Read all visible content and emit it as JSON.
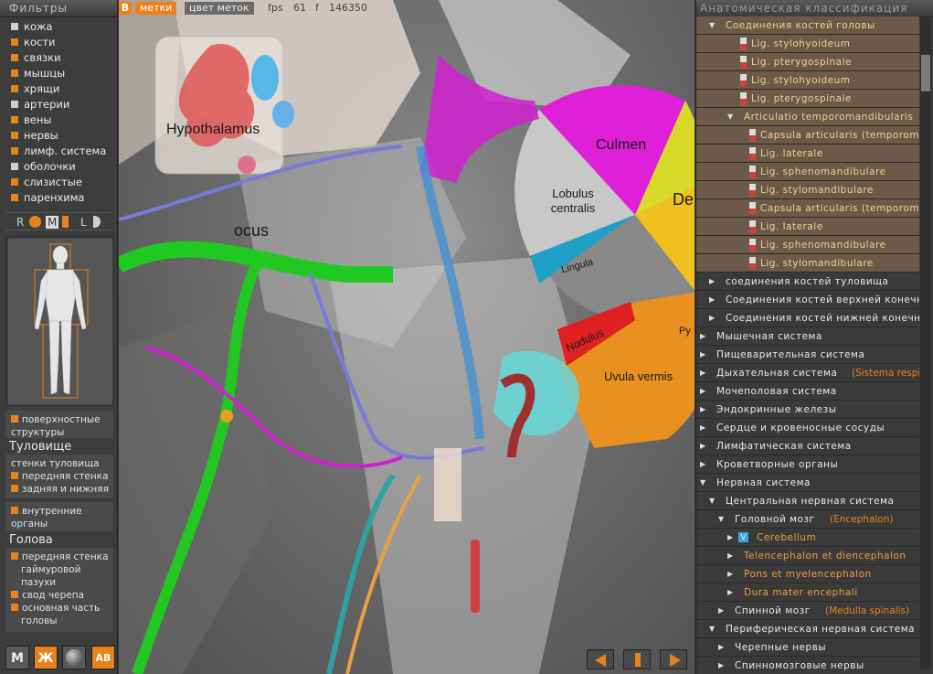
{
  "left": {
    "title": "Фильтры",
    "filters": [
      {
        "label": "кожа",
        "color": "#cfcfcf"
      },
      {
        "label": "кости",
        "color": "#e8821c"
      },
      {
        "label": "связки",
        "color": "#e8821c"
      },
      {
        "label": "мышцы",
        "color": "#e8821c"
      },
      {
        "label": "хрящи",
        "color": "#e8821c"
      },
      {
        "label": "артерии",
        "color": "#cfcfcf"
      },
      {
        "label": "вены",
        "color": "#e8821c"
      },
      {
        "label": "нервы",
        "color": "#e8821c"
      },
      {
        "label": "лимф. система",
        "color": "#e8821c"
      },
      {
        "label": "оболочки",
        "color": "#cfcfcf"
      },
      {
        "label": "слизистые",
        "color": "#e8821c"
      },
      {
        "label": "паренхима",
        "color": "#e8821c"
      }
    ],
    "lod": {
      "r": "R",
      "m": "M",
      "l": "L"
    },
    "surface": "поверхностные структуры",
    "trunk_title": "Туловище",
    "trunk": {
      "walls": "стенки туловища",
      "front": "передняя стенка",
      "back": "задняя и нижняя"
    },
    "internal": "внутренние органы",
    "head_title": "Голова",
    "head": [
      "передняя стенка гаймуровой пазухи",
      "свод черепа",
      "основная часть головы"
    ],
    "buttons": {
      "m": "М",
      "zh": "Ж",
      "ab": "АВ"
    }
  },
  "viewport": {
    "tab_b": "B",
    "tab_marks": "метки",
    "tab_color": "цвет  меток",
    "fps_label": "fps",
    "fps": "61",
    "f_label": "f",
    "f_value": "146350",
    "labels": {
      "hypothalamus": "Hypothalamus",
      "culmen": "Culmen",
      "lobulus": "Lobulus centralis",
      "lingula": "Lingula",
      "nodulus": "Nodulus",
      "uvula": "Uvula  vermis",
      "locus": "ocus",
      "declive": "De",
      "py": "Py"
    }
  },
  "right": {
    "title": "Анатомическая классификация",
    "rows": [
      {
        "text": "Соединения  костей  головы",
        "indent": 1,
        "arrow": "down",
        "style": "lig"
      },
      {
        "text": "Lig.  stylohyoideum",
        "indent": 4,
        "pin": "ar",
        "style": "lig"
      },
      {
        "text": "Lig.  pterygospinale",
        "indent": 4,
        "pin": "ar",
        "style": "lig"
      },
      {
        "text": "Lig.  stylohyoideum",
        "indent": 4,
        "pin": "ar",
        "style": "lig"
      },
      {
        "text": "Lig.  pterygospinale",
        "indent": 4,
        "pin": "ar",
        "style": "lig"
      },
      {
        "text": "Articulatio  temporomandibularis",
        "indent": 3,
        "arrow": "down",
        "style": "lig"
      },
      {
        "text": "Capsula  articularis  (temporoma",
        "indent": 5,
        "pin": "ar",
        "style": "lig"
      },
      {
        "text": "Lig.  laterale",
        "indent": 5,
        "pin": "ar",
        "style": "lig"
      },
      {
        "text": "Lig.  sphenomandibulare",
        "indent": 5,
        "pin": "ar",
        "style": "lig"
      },
      {
        "text": "Lig.  stylomandibulare",
        "indent": 5,
        "pin": "ar",
        "style": "lig"
      },
      {
        "text": "Capsula  articularis  (temporoma",
        "indent": 5,
        "pin": "ar",
        "style": "lig"
      },
      {
        "text": "Lig.  laterale",
        "indent": 5,
        "pin": "ar",
        "style": "lig"
      },
      {
        "text": "Lig.  sphenomandibulare",
        "indent": 5,
        "pin": "ar",
        "style": "lig"
      },
      {
        "text": "Lig.  stylomandibulare",
        "indent": 5,
        "pin": "ar",
        "style": "lig"
      },
      {
        "text": "соединения  костей  туловища",
        "indent": 1,
        "arrow": "right"
      },
      {
        "text": "Соединения  костей  верхней  конечнос",
        "indent": 1,
        "arrow": "right"
      },
      {
        "text": "Соединения  костей  нижней  конечнос",
        "indent": 1,
        "arrow": "right"
      },
      {
        "text": "Мышечная  система",
        "indent": 0,
        "arrow": "right"
      },
      {
        "text": "Пищеварительная  система",
        "indent": 0,
        "arrow": "right"
      },
      {
        "text": "Дыхательная  система",
        "lat": "(Sistema  respi",
        "indent": 0,
        "arrow": "right"
      },
      {
        "text": "Мочеполовая  система",
        "indent": 0,
        "arrow": "right"
      },
      {
        "text": "Эндокринные  железы",
        "indent": 0,
        "arrow": "right"
      },
      {
        "text": "Сердце  и  кровеносные  сосуды",
        "indent": 0,
        "arrow": "right"
      },
      {
        "text": "Лимфатическая  система",
        "indent": 0,
        "arrow": "right"
      },
      {
        "text": "Кроветворные  органы",
        "indent": 0,
        "arrow": "right"
      },
      {
        "text": "Нервная  система",
        "indent": 0,
        "arrow": "down"
      },
      {
        "text": "Центральная  нервная  система",
        "indent": 1,
        "arrow": "down"
      },
      {
        "text": "Головной  мозг",
        "lat": "(Encephalon)",
        "indent": 2,
        "arrow": "down"
      },
      {
        "text": "Cerebellum",
        "indent": 3,
        "arrow": "right",
        "checked": true,
        "style": "cer"
      },
      {
        "text": "Telencephalon  et  diencephalon",
        "indent": 3,
        "arrow": "right",
        "style": "cer"
      },
      {
        "text": "Pons  et  myelencephalon",
        "indent": 3,
        "arrow": "right",
        "style": "cer"
      },
      {
        "text": "Dura  mater  encephali",
        "indent": 3,
        "arrow": "right",
        "style": "cer"
      },
      {
        "text": "Спинной  мозг",
        "lat": "(Medulla  spinalis)",
        "indent": 2,
        "arrow": "right"
      },
      {
        "text": "Периферическая  нервная  система",
        "indent": 1,
        "arrow": "down"
      },
      {
        "text": "Черепные  нервы",
        "indent": 2,
        "arrow": "right"
      },
      {
        "text": "Спинномозговые  нервы",
        "indent": 2,
        "arrow": "right"
      }
    ]
  }
}
